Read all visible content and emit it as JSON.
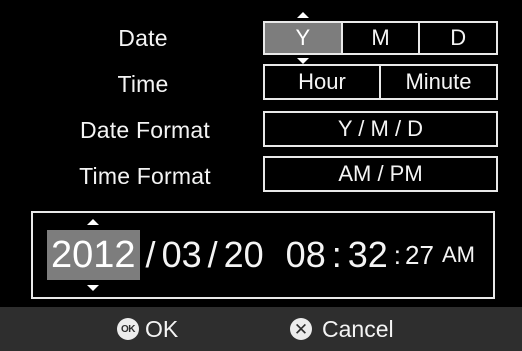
{
  "rows": {
    "date": {
      "label": "Date",
      "options": [
        "Y",
        "M",
        "D"
      ],
      "selected": "Y"
    },
    "time": {
      "label": "Time",
      "options": [
        "Hour",
        "Minute"
      ]
    },
    "date_format": {
      "label": "Date Format",
      "value": "Y / M / D"
    },
    "time_format": {
      "label": "Time Format",
      "value": "AM / PM"
    }
  },
  "datetime": {
    "year": "2012",
    "sep1": "/",
    "month": "03",
    "sep2": "/",
    "day": "20",
    "hour": "08",
    "colon1": ":",
    "minute": "32",
    "colon2": ":",
    "second": "27",
    "ampm": "AM"
  },
  "footer": {
    "ok_icon": "OK",
    "ok_label": "OK",
    "cancel_icon": "✕",
    "cancel_label": "Cancel"
  },
  "colors": {
    "background": "#000000",
    "selected": "#7d7d7d",
    "footer": "#2e2e2e"
  }
}
